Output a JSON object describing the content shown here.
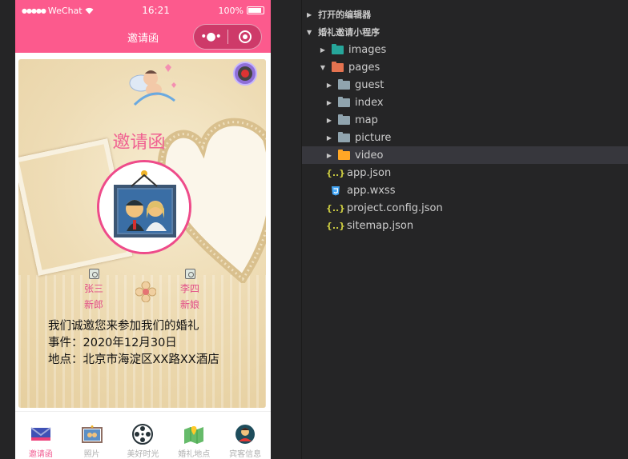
{
  "status_bar": {
    "carrier": "WeChat",
    "time": "16:21",
    "battery": "100%"
  },
  "nav": {
    "title": "邀请函"
  },
  "invitation": {
    "title": "邀请函",
    "groom": {
      "name": "张三",
      "role": "新郎"
    },
    "bride": {
      "name": "李四",
      "role": "新娘"
    },
    "lines": [
      "我们诚邀您来参加我们的婚礼",
      "事件：2020年12月30日",
      "地点：北京市海淀区XX路XX酒店"
    ]
  },
  "tabs": [
    {
      "label": "邀请函",
      "icon": "envelope-icon",
      "active": true
    },
    {
      "label": "照片",
      "icon": "photo-icon",
      "active": false
    },
    {
      "label": "美好时光",
      "icon": "film-reel-icon",
      "active": false
    },
    {
      "label": "婚礼地点",
      "icon": "map-icon",
      "active": false
    },
    {
      "label": "宾客信息",
      "icon": "guest-avatar-icon",
      "active": false
    }
  ],
  "explorer": {
    "open_editors": "打开的编辑器",
    "project": "婚礼邀请小程序",
    "items": [
      {
        "name": "images",
        "type": "folder",
        "icon": "images-folder-icon",
        "color": "#26a69a"
      },
      {
        "name": "pages",
        "type": "folder-open",
        "icon": "pages-folder-icon",
        "color": "#e57350"
      },
      {
        "name": "guest",
        "type": "folder",
        "icon": "folder-icon"
      },
      {
        "name": "index",
        "type": "folder",
        "icon": "folder-icon"
      },
      {
        "name": "map",
        "type": "folder",
        "icon": "folder-icon"
      },
      {
        "name": "picture",
        "type": "folder",
        "icon": "folder-icon"
      },
      {
        "name": "video",
        "type": "folder",
        "icon": "video-folder-icon",
        "color": "#ffa726",
        "selected": true
      },
      {
        "name": "app.json",
        "type": "json",
        "icon": "json-icon"
      },
      {
        "name": "app.wxss",
        "type": "css",
        "icon": "css-icon"
      },
      {
        "name": "project.config.json",
        "type": "json",
        "icon": "json-icon"
      },
      {
        "name": "sitemap.json",
        "type": "json",
        "icon": "json-icon"
      }
    ]
  }
}
